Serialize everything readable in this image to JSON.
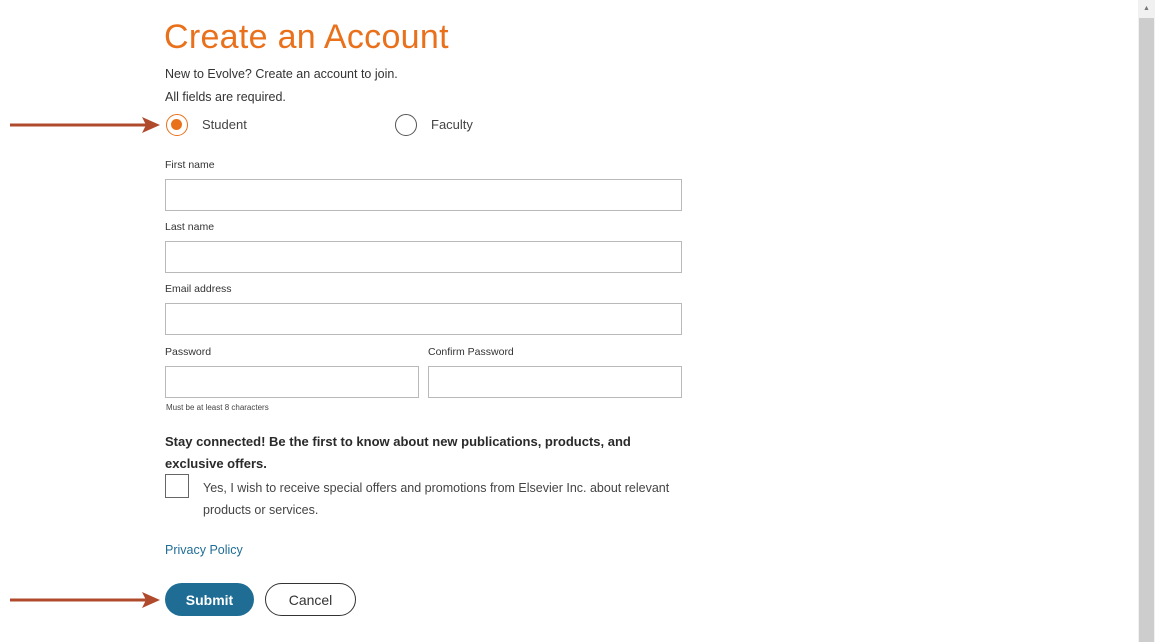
{
  "form": {
    "title": "Create an Account",
    "subtitle": "New to Evolve? Create an account to join.",
    "required_note": "All fields are required.",
    "roles": [
      {
        "label": "Student",
        "selected": true
      },
      {
        "label": "Faculty",
        "selected": false
      }
    ],
    "fields": {
      "first_name": {
        "label": "First name",
        "value": ""
      },
      "last_name": {
        "label": "Last name",
        "value": ""
      },
      "email": {
        "label": "Email address",
        "value": ""
      },
      "password": {
        "label": "Password",
        "value": ""
      },
      "confirm_password": {
        "label": "Confirm Password",
        "value": ""
      }
    },
    "password_hint": "Must be at least 8 characters",
    "stay_connected": "Stay connected! Be the first to know about new publications, products, and exclusive offers.",
    "opt_in_label": "Yes, I wish to receive special offers and promotions from Elsevier Inc. about relevant products or services.",
    "opt_in_checked": false,
    "privacy_link": "Privacy Policy",
    "submit_label": "Submit",
    "cancel_label": "Cancel"
  },
  "colors": {
    "accent": "#e9711c",
    "primary_button": "#1f6d95",
    "annotation_arrow": "#b04a2c"
  }
}
